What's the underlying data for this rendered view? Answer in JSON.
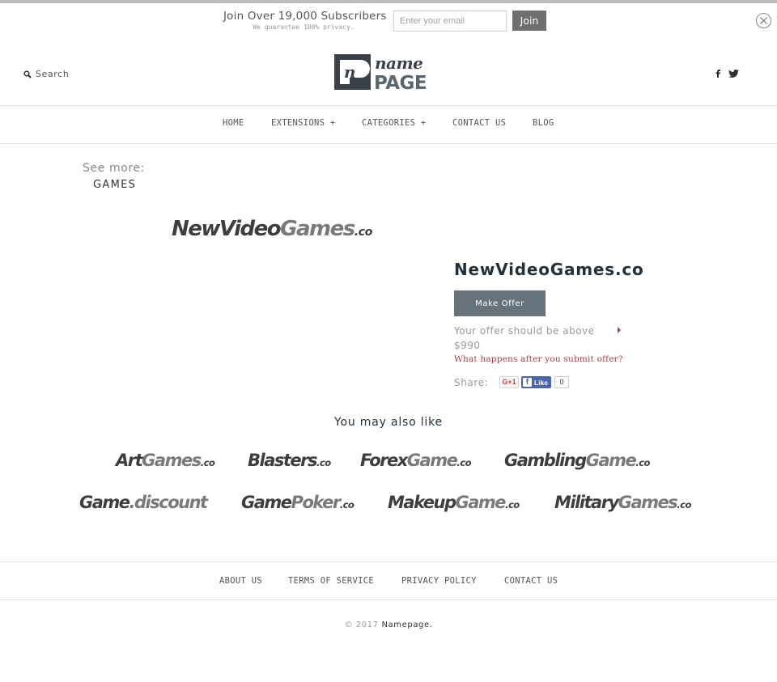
{
  "subscribe": {
    "title": "Join Over 19,000 Subscribers",
    "note": "We guarantee 100% privacy.",
    "email_placeholder": "Enter your email",
    "email_value": "",
    "join_label": "Join",
    "close_icon": "close-circle-icon"
  },
  "header": {
    "search_label": "Search",
    "search_icon": "search-icon",
    "logo": {
      "top": "name",
      "bottom": "PAGE",
      "mark": "n"
    },
    "social": [
      {
        "name": "facebook",
        "glyph": "f"
      },
      {
        "name": "twitter",
        "glyph": "bird"
      }
    ]
  },
  "nav": {
    "items": [
      {
        "label": "HOME"
      },
      {
        "label": "EXTENSIONS +"
      },
      {
        "label": "CATEGORIES +"
      },
      {
        "label": "CONTACT US"
      },
      {
        "label": "BLOG"
      }
    ]
  },
  "see_more": {
    "label": "See more:",
    "category": "GAMES"
  },
  "domain": {
    "logo": {
      "a": "NewVideo",
      "b": "Games",
      "c": ".co"
    },
    "name": "NewVideoGames.co",
    "make_offer_label": "Make Offer",
    "offer_hint": "Your offer should be above $990",
    "what_happens_link": "What happens after you submit offer?",
    "share_label": "Share:",
    "gplus_label": "G+1",
    "fb_like_label": "Like",
    "fb_like_count": "0"
  },
  "recommendations": {
    "heading": "You may also like",
    "items": [
      {
        "a": "Art",
        "b": "Games",
        "c": ".co"
      },
      {
        "a": "Blasters",
        "b": "",
        "c": ".co"
      },
      {
        "a": "Forex",
        "b": "Game",
        "c": ".co"
      },
      {
        "a": "Gambling",
        "b": "Game",
        "c": ".co"
      },
      {
        "a": "Game",
        "b": ".discount",
        "c": ""
      },
      {
        "a": "Game",
        "b": "Poker",
        "c": ".co"
      },
      {
        "a": "Makeup",
        "b": "Game",
        "c": ".co"
      },
      {
        "a": "Military",
        "b": "Games",
        "c": ".co"
      }
    ]
  },
  "footer": {
    "links": [
      {
        "label": "ABOUT US"
      },
      {
        "label": "TERMS OF SERVICE"
      },
      {
        "label": "PRIVACY POLICY"
      },
      {
        "label": "CONTACT US"
      }
    ],
    "copyright_prefix": "© 2017",
    "copyright_brand": "Namepage."
  }
}
